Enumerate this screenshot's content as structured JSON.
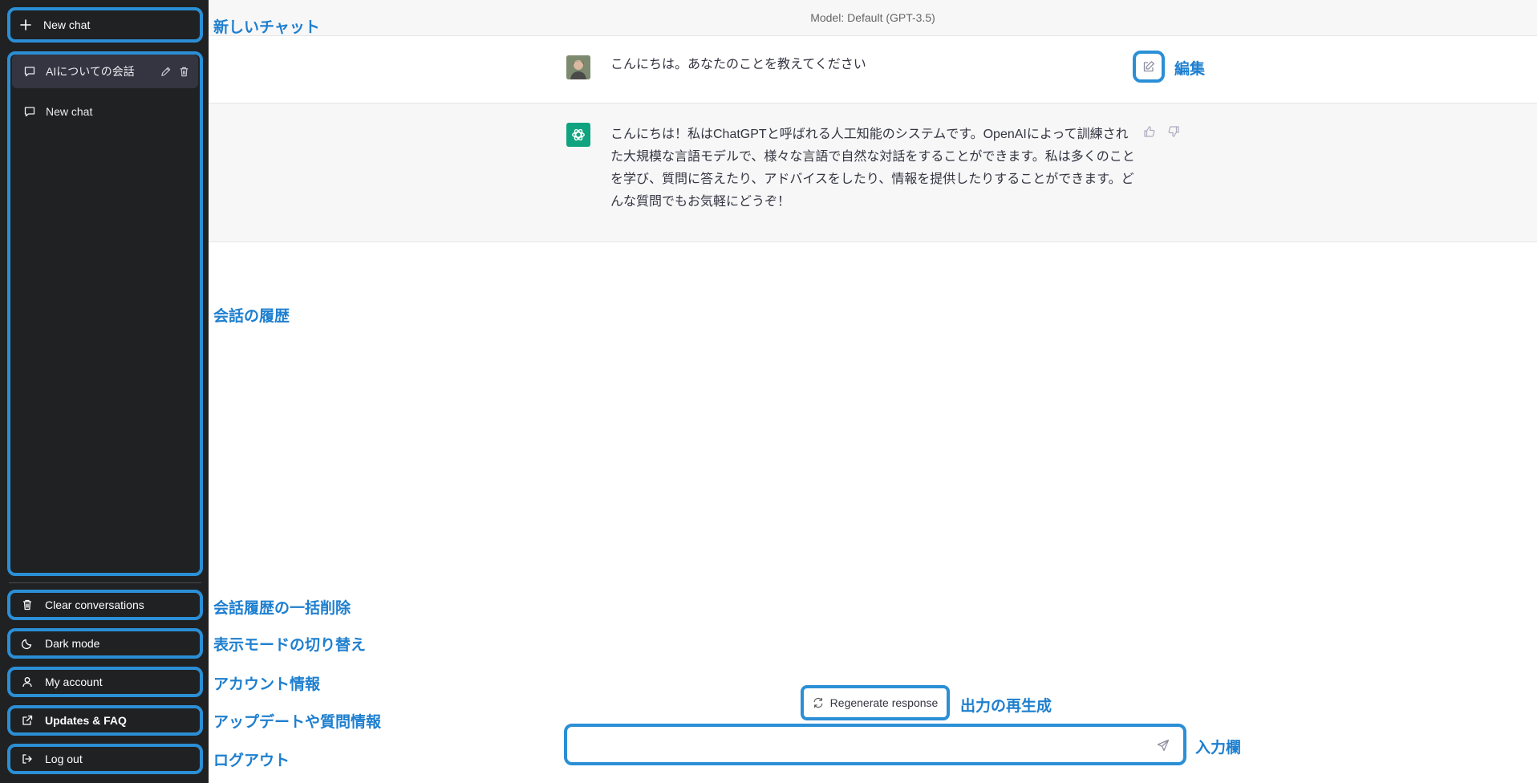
{
  "sidebar": {
    "new_chat_label": "New chat",
    "history": [
      {
        "label": "AIについての会話",
        "active": true
      },
      {
        "label": "New chat",
        "active": false
      }
    ],
    "clear_label": "Clear conversations",
    "dark_mode_label": "Dark mode",
    "account_label": "My account",
    "updates_label": "Updates & FAQ",
    "logout_label": "Log out"
  },
  "main": {
    "model_label": "Model: Default (GPT-3.5)",
    "user_message": "こんにちは。あなたのことを教えてください",
    "bot_message_lines": [
      "こんにちは！私はChatGPTと呼ばれる人工知能のシステムです。OpenAIによって訓練され",
      "た大規模な言語モデルで、様々な言語で自然な対話をすることができます。私は多くのこと",
      "を学び、質問に答えたり、アドバイスをしたり、情報を提供したりすることができます。ど",
      "んな質問でもお気軽にどうぞ！"
    ],
    "regenerate_label": "Regenerate response",
    "input_value": "",
    "input_placeholder": ""
  },
  "annotations": {
    "new_chat": "新しいチャット",
    "history": "会話の履歴",
    "clear": "会話履歴の一括削除",
    "display_mode": "表示モードの切り替え",
    "account": "アカウント情報",
    "updates": "アップデートや質問情報",
    "logout": "ログアウト",
    "edit": "編集",
    "regenerate": "出力の再生成",
    "input": "入力欄"
  },
  "colors": {
    "sidebar_bg": "#202123",
    "highlight": "#2b8fd6",
    "annotation_text": "#1e7fcf",
    "assistant_avatar": "#10a37f"
  }
}
